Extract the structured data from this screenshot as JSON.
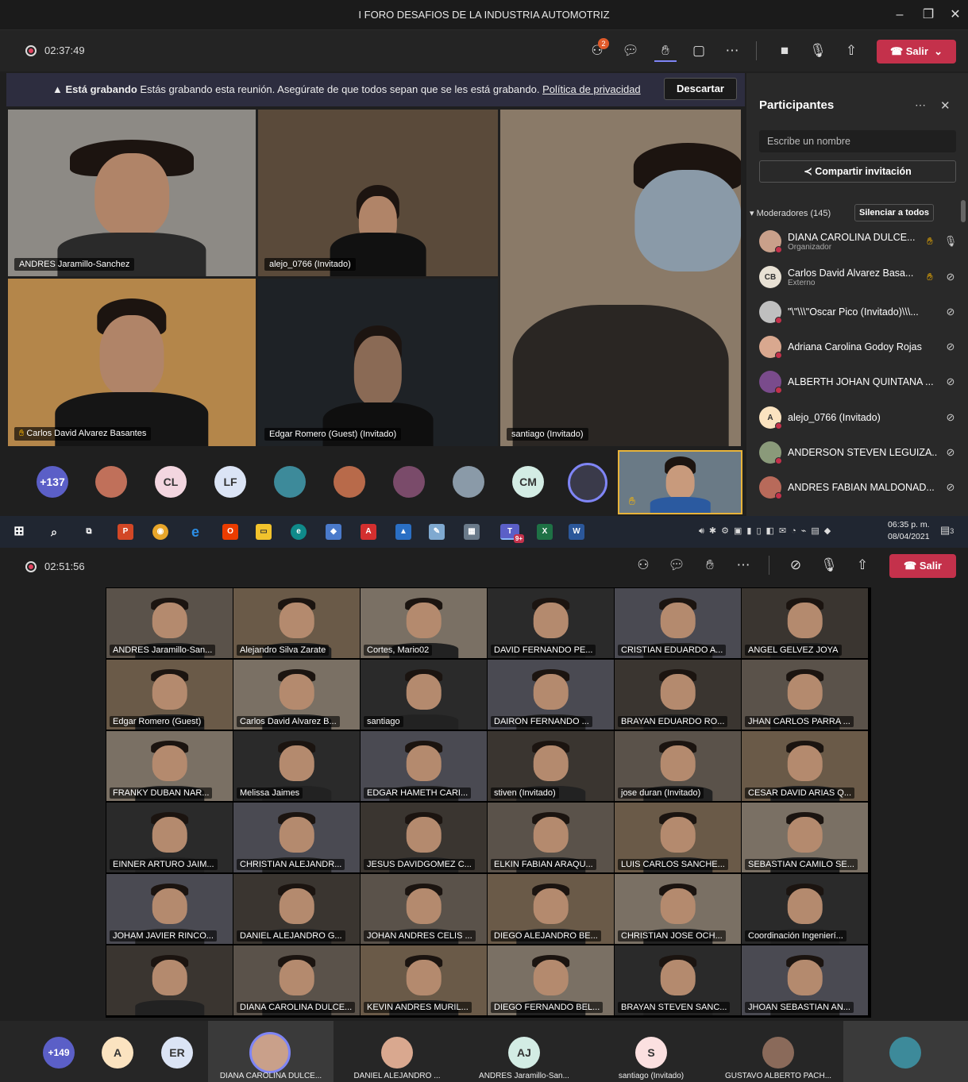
{
  "window": {
    "title": "I FORO DESAFIOS DE LA INDUSTRIA AUTOMOTRIZ"
  },
  "meeting1": {
    "timer": "02:37:49",
    "people_badge": "2",
    "leave_label": "Salir",
    "banner": {
      "title": "Está grabando",
      "text": "Estás grabando esta reunión. Asegúrate de que todos sepan que se les está grabando.",
      "link": "Política de privacidad",
      "dismiss": "Descartar"
    },
    "tiles": [
      {
        "name": "ANDRES Jaramillo-Sanchez"
      },
      {
        "name": "alejo_0766 (Invitado)"
      },
      {
        "name": "santiago (Invitado)"
      },
      {
        "name": "Carlos David Alvarez Basantes"
      },
      {
        "name": "Edgar Romero (Guest) (Invitado)"
      }
    ],
    "strip": {
      "overflow": "+137",
      "initials": [
        "CL",
        "LF",
        "CM"
      ]
    }
  },
  "participants": {
    "title": "Participantes",
    "search_placeholder": "Escribe un nombre",
    "share_label": "Compartir invitación",
    "section": "Moderadores (145)",
    "mute_all": "Silenciar a todos",
    "items": [
      {
        "name": "DIANA CAROLINA DULCE...",
        "sub": "Organizador",
        "initials": "",
        "color": "#c9a08a"
      },
      {
        "name": "Carlos David Alvarez Basa...",
        "sub": "Externo",
        "initials": "CB",
        "color": "#e8e1d4"
      },
      {
        "name": "\"\\\"\\\\\\\"Oscar Pico (Invitado)\\\\\\...",
        "sub": "",
        "initials": "",
        "color": "#bfbfbf"
      },
      {
        "name": "Adriana Carolina Godoy Rojas",
        "sub": "",
        "initials": "",
        "color": "#d9a88f"
      },
      {
        "name": "ALBERTH JOHAN QUINTANA ...",
        "sub": "",
        "initials": "",
        "color": "#7a4b8c"
      },
      {
        "name": "alejo_0766 (Invitado)",
        "sub": "",
        "initials": "A",
        "color": "#fbe3c0"
      },
      {
        "name": "ANDERSON STEVEN LEGUIZA...",
        "sub": "",
        "initials": "",
        "color": "#8a9a7a"
      },
      {
        "name": "ANDRES FABIAN MALDONAD...",
        "sub": "",
        "initials": "",
        "color": "#b86a5a"
      }
    ]
  },
  "taskbar": {
    "time": "06:35 p. m.",
    "date": "08/04/2021",
    "notif": "3",
    "teams_badge": "9+"
  },
  "meeting2": {
    "timer": "02:51:56",
    "leave_label": "Salir",
    "cells": [
      [
        "ANDRES Jaramillo-San...",
        "Alejandro Silva Zarate",
        "Cortes, Mario02",
        "DAVID FERNANDO PE...",
        "CRISTIAN EDUARDO A...",
        "ANGEL  GELVEZ JOYA"
      ],
      [
        "Edgar Romero (Guest)",
        "Carlos David Alvarez B...",
        "santiago",
        "DAIRON FERNANDO ...",
        "BRAYAN EDUARDO RO...",
        "JHAN CARLOS PARRA ..."
      ],
      [
        "FRANKY DUBAN NAR...",
        "Melissa Jaimes",
        "EDGAR HAMETH CARI...",
        "stiven (Invitado)",
        "jose duran (Invitado)",
        "CESAR DAVID ARIAS Q..."
      ],
      [
        "EINNER ARTURO JAIM...",
        "CHRISTIAN ALEJANDR...",
        "JESUS DAVIDGOMEZ C...",
        "ELKIN FABIAN ARAQU...",
        "LUIS CARLOS SANCHE...",
        "SEBASTIAN CAMILO SE..."
      ],
      [
        "JOHAM JAVIER RINCO...",
        "DANIEL ALEJANDRO G...",
        "JOHAN ANDRES CELIS ...",
        "DIEGO ALEJANDRO BE...",
        "CHRISTIAN JOSE OCH...",
        "Coordinación Ingenierí..."
      ],
      [
        "",
        "DIANA CAROLINA DULCE...",
        "KEVIN ANDRES MURIL...",
        "DIEGO FERNANDO BEL...",
        "BRAYAN STEVEN SANC...",
        "JHOAN SEBASTIAN AN..."
      ]
    ],
    "bottom": {
      "overflow": "+149",
      "initials": [
        "A",
        "ER",
        "AJ",
        "S"
      ],
      "names": [
        "DIANA CAROLINA DULCE...",
        "DANIEL ALEJANDRO ...",
        "ANDRES Jaramillo-San...",
        "santiago (Invitado)",
        "GUSTAVO ALBERTO PACH..."
      ]
    }
  }
}
